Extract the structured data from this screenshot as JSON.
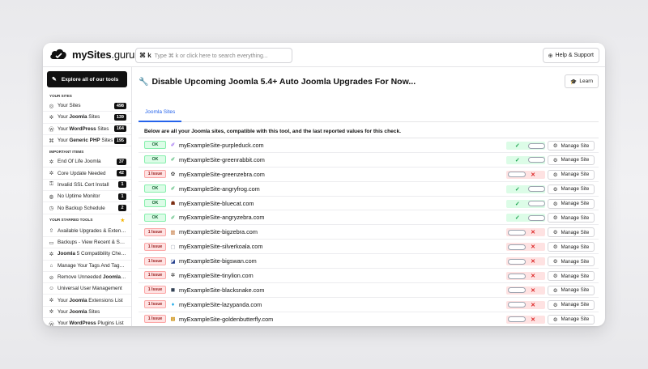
{
  "brand": {
    "name_bold": "mySites",
    "name_rest": ".guru"
  },
  "search": {
    "kbd": "⌘ k",
    "placeholder": "Type ⌘ k or click here to search everything..."
  },
  "help": {
    "label": "Help & Support"
  },
  "sidebar": {
    "explore_label": "Explore all of our tools",
    "sections": [
      {
        "title": "Your Sites",
        "items": [
          {
            "icon": "globe-icon",
            "glyph": "◎",
            "pre": "Your ",
            "bold": "",
            "post": "Sites",
            "badge": "498"
          },
          {
            "icon": "joomla-icon",
            "glyph": "✲",
            "pre": "Your ",
            "bold": "Joomla",
            "post": " Sites",
            "badge": "139"
          },
          {
            "icon": "wordpress-icon",
            "glyph": "Ⓦ",
            "pre": "Your ",
            "bold": "WordPress",
            "post": " Sites",
            "badge": "164"
          },
          {
            "icon": "php-icon",
            "glyph": "⌘",
            "pre": "Your ",
            "bold": "Generic PHP",
            "post": " Sites",
            "badge": "195"
          }
        ]
      },
      {
        "title": "Important Items",
        "items": [
          {
            "icon": "joomla-icon",
            "glyph": "✲",
            "pre": "End Of Life Joomla",
            "bold": "",
            "post": "",
            "badge": "37"
          },
          {
            "icon": "joomla-icon",
            "glyph": "✲",
            "pre": "Core Update Needed",
            "bold": "",
            "post": "",
            "badge": "42"
          },
          {
            "icon": "ssl-icon",
            "glyph": "⚿",
            "pre": "Invalid SSL Cert Install",
            "bold": "",
            "post": "",
            "badge": "1"
          },
          {
            "icon": "monitor-icon",
            "glyph": "◍",
            "pre": "No Uptime Monitor",
            "bold": "",
            "post": "",
            "badge": "1"
          },
          {
            "icon": "clock-icon",
            "glyph": "◷",
            "pre": "No Backup Schedule",
            "bold": "",
            "post": "",
            "badge": "2"
          }
        ]
      },
      {
        "title": "Your Starred Tools",
        "star": "★",
        "items": [
          {
            "icon": "upgrade-icon",
            "glyph": "⇧",
            "pre": "Available Upgrades & Extensi...",
            "bold": "",
            "post": "",
            "badge": ""
          },
          {
            "icon": "backup-icon",
            "glyph": "▭",
            "pre": "Backups - View Recent & Set...",
            "bold": "",
            "post": "",
            "badge": ""
          },
          {
            "icon": "joomla-icon",
            "glyph": "✲",
            "pre": "",
            "bold": "Joomla",
            "post": " 5 Compatibility Chec...",
            "badge": ""
          },
          {
            "icon": "tag-icon",
            "glyph": "⌂",
            "pre": "Manage Your Tags And Taggi...",
            "bold": "",
            "post": "",
            "badge": ""
          },
          {
            "icon": "unlink-icon",
            "glyph": "⊘",
            "pre": "Remove Unneeded ",
            "bold": "Joomla",
            "post": " C...",
            "badge": ""
          },
          {
            "icon": "user-icon",
            "glyph": "☺",
            "pre": "Universal User Management",
            "bold": "",
            "post": "",
            "badge": ""
          },
          {
            "icon": "joomla-icon",
            "glyph": "✲",
            "pre": "Your ",
            "bold": "Joomla",
            "post": " Extensions List",
            "badge": ""
          },
          {
            "icon": "joomla-icon",
            "glyph": "✲",
            "pre": "Your ",
            "bold": "Joomla",
            "post": " Sites",
            "badge": ""
          },
          {
            "icon": "wordpress-icon",
            "glyph": "Ⓦ",
            "pre": "Your ",
            "bold": "WordPress",
            "post": " Plugins List",
            "badge": ""
          }
        ]
      }
    ]
  },
  "main": {
    "title": "Disable Upcoming Joomla 5.4+ Auto Joomla Upgrades For Now...",
    "learn_label": "Learn",
    "tab_label": "Joomla Sites",
    "intro": "Below are all your Joomla sites, compatible with this tool, and the last reported values for this check.",
    "manage_label": "Manage Site",
    "rows": [
      {
        "status": "ok",
        "status_label": "OK",
        "fav": "✐",
        "fav_color": "#7c3aed",
        "site": "myExampleSite-purpleduck.com"
      },
      {
        "status": "ok",
        "status_label": "OK",
        "fav": "✐",
        "fav_color": "#16a34a",
        "site": "myExampleSite-greenrabbit.com"
      },
      {
        "status": "issue",
        "status_label": "1 Issue",
        "fav": "✿",
        "fav_color": "#333333",
        "site": "myExampleSite-greenzebra.com"
      },
      {
        "status": "ok",
        "status_label": "OK",
        "fav": "✐",
        "fav_color": "#16a34a",
        "site": "myExampleSite-angryfrog.com"
      },
      {
        "status": "ok",
        "status_label": "OK",
        "fav": "☗",
        "fav_color": "#7c2d12",
        "site": "myExampleSite-bluecat.com"
      },
      {
        "status": "ok",
        "status_label": "OK",
        "fav": "✐",
        "fav_color": "#16a34a",
        "site": "myExampleSite-angryzebra.com"
      },
      {
        "status": "issue",
        "status_label": "1 Issue",
        "fav": "▥",
        "fav_color": "#b45309",
        "site": "myExampleSite-bigzebra.com"
      },
      {
        "status": "issue",
        "status_label": "1 Issue",
        "fav": "▢",
        "fav_color": "#9ca3af",
        "site": "myExampleSite-silverkoala.com"
      },
      {
        "status": "issue",
        "status_label": "1 Issue",
        "fav": "◪",
        "fav_color": "#1e3a8a",
        "site": "myExampleSite-bigswan.com"
      },
      {
        "status": "issue",
        "status_label": "1 Issue",
        "fav": "✲",
        "fav_color": "#111111",
        "site": "myExampleSite-tinylion.com"
      },
      {
        "status": "issue",
        "status_label": "1 Issue",
        "fav": "◼",
        "fav_color": "#334155",
        "site": "myExampleSite-blacksnake.com"
      },
      {
        "status": "issue",
        "status_label": "1 Issue",
        "fav": "♦",
        "fav_color": "#0ea5e9",
        "site": "myExampleSite-lazypanda.com"
      },
      {
        "status": "issue",
        "status_label": "1 Issue",
        "fav": "▩",
        "fav_color": "#ca8a04",
        "site": "myExampleSite-goldenbutterfly.com"
      }
    ]
  }
}
